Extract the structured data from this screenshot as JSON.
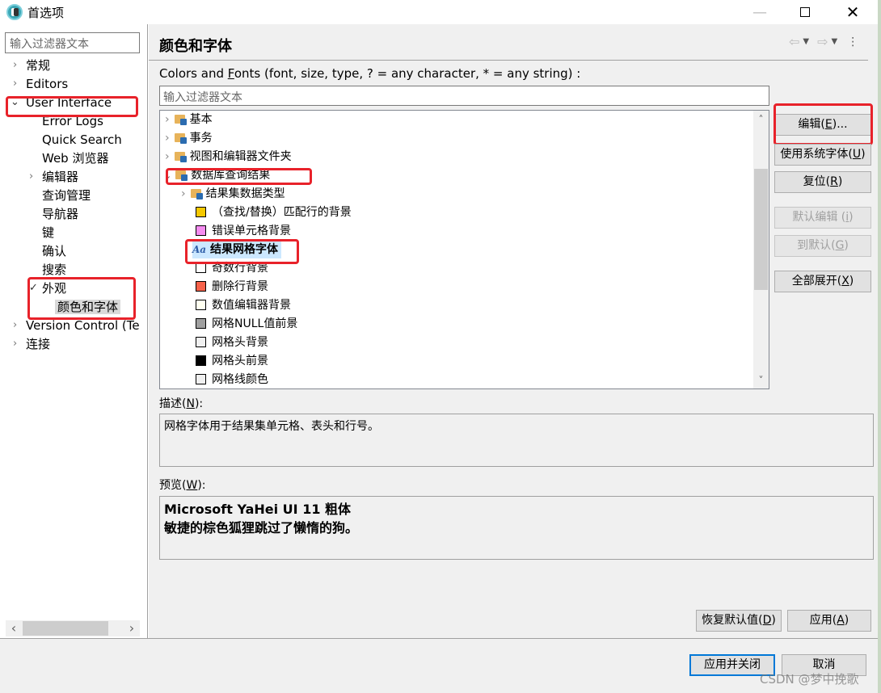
{
  "window": {
    "title": "首选项",
    "minimize_glyph": "—",
    "close_glyph": "✕"
  },
  "left_nav": {
    "filter_placeholder": "输入过滤器文本",
    "items": [
      {
        "label": "常规",
        "expanded": false,
        "has_children": true
      },
      {
        "label": "Editors",
        "expanded": false,
        "has_children": true
      },
      {
        "label": "User Interface",
        "expanded": true,
        "has_children": true
      },
      {
        "label": "Error Logs",
        "level": 1
      },
      {
        "label": "Quick Search",
        "level": 1
      },
      {
        "label": "Web 浏览器",
        "level": 1
      },
      {
        "label": "编辑器",
        "level": 1,
        "has_children": true
      },
      {
        "label": "查询管理",
        "level": 1
      },
      {
        "label": "导航器",
        "level": 1
      },
      {
        "label": "键",
        "level": 1
      },
      {
        "label": "确认",
        "level": 1
      },
      {
        "label": "搜索",
        "level": 1
      },
      {
        "label": "外观",
        "level": 1,
        "expanded": true
      },
      {
        "label": "颜色和字体",
        "level": 2,
        "selected": true
      },
      {
        "label": "Version Control (Te",
        "has_children": true
      },
      {
        "label": "连接",
        "has_children": true
      }
    ],
    "chevron_right": "›",
    "chevron_down": "⌄",
    "scroll_left": "‹",
    "scroll_right": "›"
  },
  "page": {
    "title": "颜色和字体",
    "filter_label_pre": "Colors and ",
    "filter_label_mnemonic": "F",
    "filter_label_post": "onts (font, size, type, ? = any character, * = any string) :",
    "filter_placeholder": "输入过滤器文本",
    "nav": {
      "back": "⇦",
      "forward": "⇨",
      "dropdown": "▼",
      "more": "⋮"
    }
  },
  "tree": {
    "items": [
      {
        "label": "基本",
        "type": "folder",
        "expandable": true
      },
      {
        "label": "事务",
        "type": "folder",
        "expandable": true
      },
      {
        "label": "视图和编辑器文件夹",
        "type": "folder",
        "expandable": true
      },
      {
        "label": "数据库查询结果",
        "type": "folder",
        "expanded": true
      },
      {
        "label": "结果集数据类型",
        "type": "folder",
        "expandable": true,
        "level": 1
      },
      {
        "label": "（查找/替换）匹配行的背景",
        "type": "color",
        "color": "#f5c800",
        "level": 1
      },
      {
        "label": "错误单元格背景",
        "type": "color",
        "color": "#f58cf0",
        "level": 1
      },
      {
        "label": "结果网格字体",
        "type": "font",
        "icon_text": "Aa",
        "level": 1,
        "selected": true
      },
      {
        "label": "奇数行背景",
        "type": "color",
        "color": "#ffffff",
        "level": 1
      },
      {
        "label": "删除行背景",
        "type": "color",
        "color": "#f7624a",
        "level": 1
      },
      {
        "label": "数值编辑器背景",
        "type": "color",
        "color": "#fffff0",
        "level": 1
      },
      {
        "label": "网格NULL值前景",
        "type": "color",
        "color": "#a0a0a0",
        "level": 1
      },
      {
        "label": "网格头背景",
        "type": "color",
        "color": "#f0f0f0",
        "level": 1
      },
      {
        "label": "网格头前景",
        "type": "color",
        "color": "#000000",
        "level": 1
      },
      {
        "label": "网格线颜色",
        "type": "color",
        "color": "#f0f0f0",
        "level": 1
      }
    ],
    "scroll_up": "˄",
    "scroll_down": "˅"
  },
  "side_buttons": {
    "edit": {
      "pre": "编辑(",
      "m": "E",
      "post": ")..."
    },
    "use_system_font": {
      "pre": "使用系统字体(",
      "m": "U",
      "post": ")"
    },
    "reset": {
      "pre": "复位(",
      "m": "R",
      "post": ")"
    },
    "edit_default": {
      "pre": "默认编辑 (",
      "m": "i",
      "post": ")"
    },
    "goto_default": {
      "pre": "到默认(",
      "m": "G",
      "post": ")"
    },
    "expand_all": {
      "pre": "全部展开(",
      "m": "X",
      "post": ")"
    }
  },
  "description": {
    "label_pre": "描述(",
    "label_m": "N",
    "label_post": "):",
    "text": "网格字体用于结果集单元格、表头和行号。"
  },
  "preview": {
    "label_pre": "预览(",
    "label_m": "W",
    "label_post": "):",
    "line1": "Microsoft YaHei UI 11 粗体",
    "line2": "敏捷的棕色狐狸跳过了懒惰的狗。"
  },
  "page_buttons": {
    "restore_defaults": {
      "pre": "恢复默认值(",
      "m": "D",
      "post": ")"
    },
    "apply": {
      "pre": "应用(",
      "m": "A",
      "post": ")"
    }
  },
  "dialog_buttons": {
    "apply_close": "应用并关闭",
    "cancel": "取消"
  },
  "watermark": "CSDN @梦中挽歌"
}
